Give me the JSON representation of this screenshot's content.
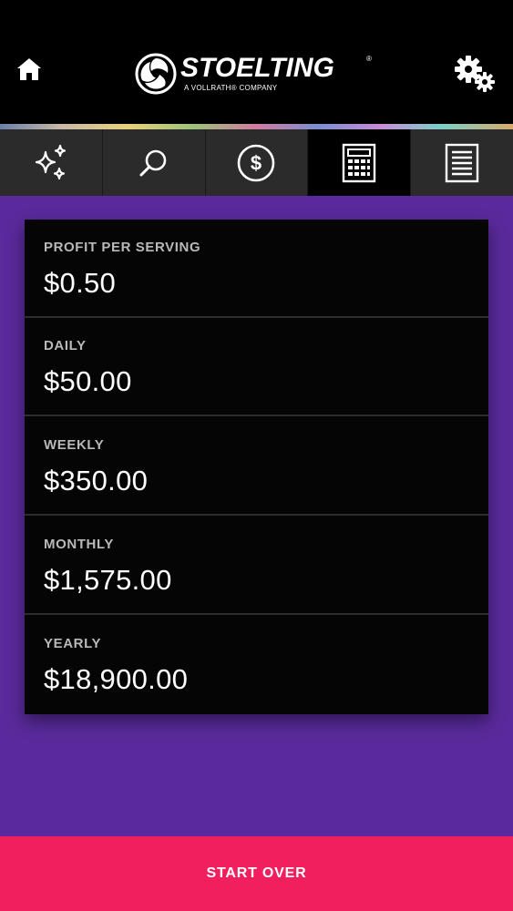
{
  "header": {
    "brand": "STOELTING",
    "brand_mark": "®",
    "tagline": "A VOLLRATH® COMPANY",
    "home_icon": "home-icon",
    "settings_icon": "gear-icon"
  },
  "tabs": [
    {
      "icon": "sparkles-icon",
      "active": false
    },
    {
      "icon": "search-icon",
      "active": false
    },
    {
      "icon": "dollar-circle-icon",
      "active": false
    },
    {
      "icon": "calculator-icon",
      "active": true
    },
    {
      "icon": "document-icon",
      "active": false
    }
  ],
  "results": [
    {
      "label": "PROFIT PER SERVING",
      "value": "$0.50"
    },
    {
      "label": "DAILY",
      "value": "$50.00"
    },
    {
      "label": "WEEKLY",
      "value": "$350.00"
    },
    {
      "label": "MONTHLY",
      "value": "$1,575.00"
    },
    {
      "label": "YEARLY",
      "value": "$18,900.00"
    }
  ],
  "footer": {
    "start_over_label": "START OVER"
  },
  "colors": {
    "background": "#5a2a9c",
    "accent": "#f21f5e",
    "card": "#050505",
    "header": "#000000"
  }
}
